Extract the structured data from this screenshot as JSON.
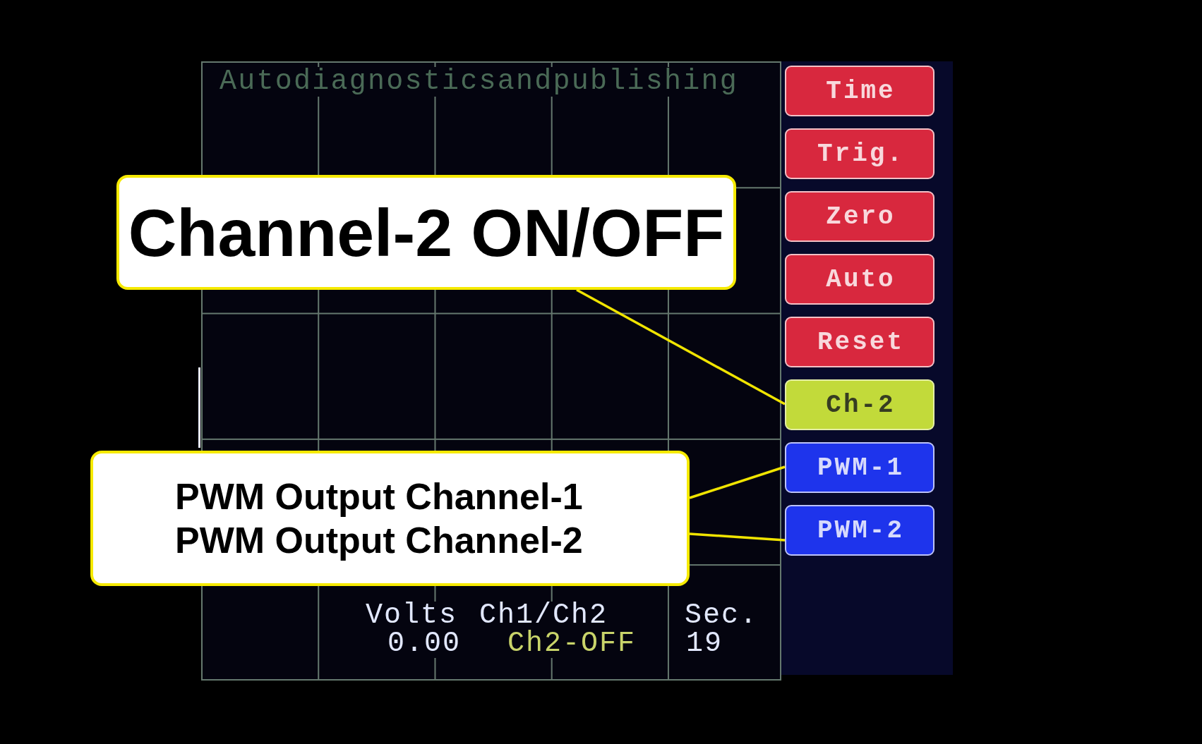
{
  "screen": {
    "title": "Autodiagnosticsandpublishing"
  },
  "readouts": [
    {
      "label": "Volts",
      "value": "0.00",
      "color": "#e2e8ff"
    },
    {
      "label": "Ch1/Ch2",
      "value": "Ch2-OFF",
      "color": "#c9d46a"
    },
    {
      "label": "Sec.",
      "value": "19",
      "color": "#e2e8ff"
    }
  ],
  "buttons": [
    {
      "label": "Time",
      "color": "#d8283e"
    },
    {
      "label": "Trig.",
      "color": "#d8283e"
    },
    {
      "label": "Zero",
      "color": "#d8283e"
    },
    {
      "label": "Auto",
      "color": "#d8283e"
    },
    {
      "label": "Reset",
      "color": "#d8283e"
    },
    {
      "label": "Ch-2",
      "color": "#c2da3a"
    },
    {
      "label": "PWM-1",
      "color": "#1e34ec"
    },
    {
      "label": "PWM-2",
      "color": "#1e34ec"
    }
  ],
  "callouts": [
    {
      "kind": "headline",
      "lines": [
        "Channel-2 ON/OFF"
      ]
    },
    {
      "kind": "list",
      "lines": [
        "PWM Output Channel-1",
        "PWM Output Channel-2"
      ]
    }
  ]
}
